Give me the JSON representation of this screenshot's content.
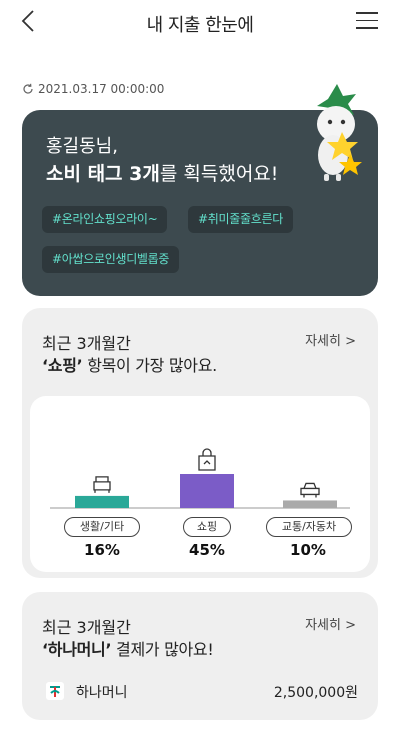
{
  "header": {
    "title": "내 지출 한눈에"
  },
  "timestamp": "2021.03.17 00:00:00",
  "tag_card": {
    "greeting": "홍길동님,",
    "headline_bold": "소비 태그 3개",
    "headline_rest": "를 획득했어요!",
    "tags": [
      "#온라인쇼핑오라이~",
      "#취미줄줄흐른다",
      "#아쌉으로인생디벨롭중"
    ],
    "colors": {
      "background": "#3d4a4f",
      "tag_text": "#63e0cc"
    }
  },
  "category_card": {
    "line1": "최근 3개월간",
    "highlight": "‘쇼핑’",
    "line2_rest": " 항목이 가장 많아요.",
    "more_label": "자세히 >",
    "categories": [
      {
        "label": "생활/기타",
        "percent": "16%",
        "icon": "sofa-icon",
        "color": "#2aa898"
      },
      {
        "label": "쇼핑",
        "percent": "45%",
        "icon": "shopping-bag-icon",
        "color": "#7b5cc7"
      },
      {
        "label": "교통/자동차",
        "percent": "10%",
        "icon": "car-icon",
        "color": "#aaaaaa"
      }
    ]
  },
  "chart_data": {
    "type": "bar",
    "categories": [
      "생활/기타",
      "쇼핑",
      "교통/자동차"
    ],
    "values": [
      16,
      45,
      10
    ],
    "ylim": [
      0,
      45
    ]
  },
  "payment_card": {
    "line1": "최근 3개월간",
    "highlight": "‘하나머니’",
    "line2_rest": " 결제가 많아요!",
    "more_label": "자세히 >",
    "method_name": "하나머니",
    "amount": "2,500,000원",
    "icon": "hana-logo-icon"
  }
}
